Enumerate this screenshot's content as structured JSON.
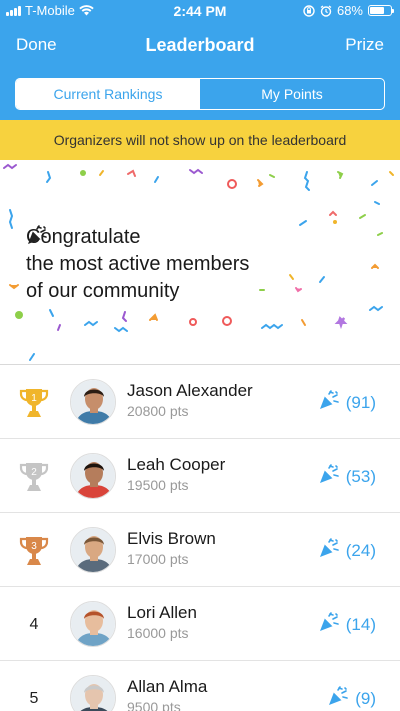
{
  "status_bar": {
    "carrier": "T-Mobile",
    "time": "2:44 PM",
    "battery": "68%",
    "battery_level": 0.68,
    "wifi_icon": "wifi-icon",
    "alarm_icon": "alarm-icon",
    "lock_icon": "rotation-lock-icon"
  },
  "nav": {
    "left": "Done",
    "title": "Leaderboard",
    "right": "Prize"
  },
  "tabs": [
    {
      "label": "Current Rankings",
      "selected": true
    },
    {
      "label": "My Points",
      "selected": false
    }
  ],
  "notice": "Organizers will not show up on the leaderboard",
  "hero": {
    "line1": "Congratulate",
    "line2": "the most active members",
    "line3": "of our community",
    "icon": "party-popper-icon"
  },
  "leaderboard": [
    {
      "rank": "1",
      "trophy": "gold",
      "name": "Jason Alexander",
      "points": "20800 pts",
      "cheers": "(91)",
      "skin": "#c68e6b",
      "hair": "#2b1d14",
      "shirt": "#3f7ba8"
    },
    {
      "rank": "2",
      "trophy": "silver",
      "name": "Leah Cooper",
      "points": "19500 pts",
      "cheers": "(53)",
      "skin": "#b57d5c",
      "hair": "#1d130d",
      "shirt": "#d9443a"
    },
    {
      "rank": "3",
      "trophy": "bronze",
      "name": "Elvis Brown",
      "points": "17000 pts",
      "cheers": "(24)",
      "skin": "#d9a882",
      "hair": "#7a5738",
      "shirt": "#5a6b7c"
    },
    {
      "rank": "4",
      "trophy": "",
      "name": "Lori Allen",
      "points": "16000 pts",
      "cheers": "(14)",
      "skin": "#e7bd9d",
      "hair": "#b5532b",
      "shirt": "#6fa3c6"
    },
    {
      "rank": "5",
      "trophy": "",
      "name": "Allan Alma",
      "points": "9500 pts",
      "cheers": "(9)",
      "skin": "#e5c5ae",
      "hair": "#c9c9c9",
      "shirt": "#3b4a5a"
    }
  ],
  "colors": {
    "accent": "#3ba4ec",
    "notice_bg": "#f7d23e",
    "gold": "#f0b52b",
    "silver": "#c5c5c5",
    "bronze": "#d9884a"
  }
}
